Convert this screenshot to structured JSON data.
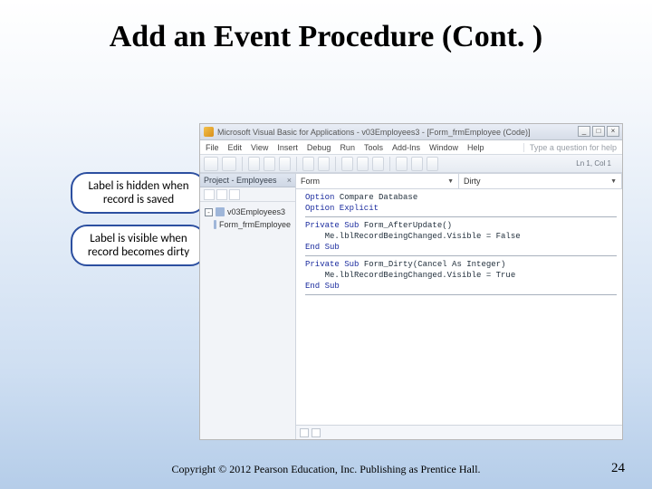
{
  "slide": {
    "title": "Add an Event Procedure (Cont. )",
    "copyright": "Copyright © 2012 Pearson Education, Inc. Publishing as Prentice Hall.",
    "page_number": "24"
  },
  "callouts": {
    "c1": "Label is hidden when record is saved",
    "c2": "Label is visible when record becomes dirty"
  },
  "vb": {
    "window_title": "Microsoft Visual Basic for Applications - v03Employees3 - [Form_frmEmployee (Code)]",
    "menus": {
      "file": "File",
      "edit": "Edit",
      "view": "View",
      "insert": "Insert",
      "debug": "Debug",
      "run": "Run",
      "tools": "Tools",
      "addins": "Add-Ins",
      "window": "Window",
      "help": "Help"
    },
    "question_box": "Type a question for help",
    "position": "Ln 1, Col 1",
    "project_panel_title": "Project - Employees",
    "project_root": "v03Employees3",
    "project_form": "Form_frmEmployee",
    "object_dropdown_left": "Form",
    "object_dropdown_right": "Dirty",
    "code": {
      "l1a": "Option ",
      "l1b": "Compare Database",
      "l2": "Option Explicit",
      "l3a": "Private Sub",
      "l3b": " Form_AfterUpdate()",
      "l4": "    Me.lblRecordBeingChanged.Visible = False",
      "l5": "End Sub",
      "l6a": "Private Sub",
      "l6b": " Form_Dirty(Cancel As Integer)",
      "l7": "    Me.lblRecordBeingChanged.Visible = True",
      "l8": "End Sub"
    }
  }
}
